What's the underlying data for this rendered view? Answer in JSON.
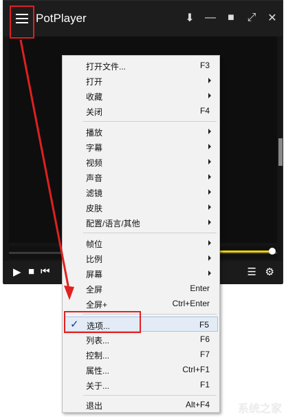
{
  "window": {
    "title": "PotPlayer",
    "controls": [
      "pin-icon",
      "minimize-icon",
      "maximize-icon",
      "fullscreen-icon",
      "close-icon"
    ]
  },
  "menu": {
    "items": [
      {
        "label": "打开文件...",
        "shortcut": "F3"
      },
      {
        "label": "打开",
        "submenu": true
      },
      {
        "label": "收藏",
        "submenu": true
      },
      {
        "label": "关闭",
        "shortcut": "F4"
      },
      {
        "label": "播放",
        "submenu": true
      },
      {
        "label": "字幕",
        "submenu": true
      },
      {
        "label": "视频",
        "submenu": true
      },
      {
        "label": "声音",
        "submenu": true
      },
      {
        "label": "滤镜",
        "submenu": true
      },
      {
        "label": "皮肤",
        "submenu": true
      },
      {
        "label": "配置/语言/其他",
        "submenu": true
      },
      {
        "label": "帧位",
        "submenu": true
      },
      {
        "label": "比例",
        "submenu": true
      },
      {
        "label": "屏幕",
        "submenu": true
      },
      {
        "label": "全屏",
        "shortcut": "Enter"
      },
      {
        "label": "全屏+",
        "shortcut": "Ctrl+Enter"
      },
      {
        "label": "选项...",
        "shortcut": "F5",
        "checked": true,
        "highlighted": true
      },
      {
        "label": "列表...",
        "shortcut": "F6"
      },
      {
        "label": "控制...",
        "shortcut": "F7"
      },
      {
        "label": "属性...",
        "shortcut": "Ctrl+F1"
      },
      {
        "label": "关于...",
        "shortcut": "F1"
      },
      {
        "label": "退出",
        "shortcut": "Alt+F4"
      }
    ]
  },
  "playback_controls": [
    "play-icon",
    "stop-icon",
    "previous-icon",
    "playlist-icon",
    "settings-icon"
  ],
  "colors": {
    "annotation_red": "#e02020",
    "volume_bar": "#f0d000",
    "menu_highlight": "#e3ecf6"
  },
  "watermark": "系统之家"
}
